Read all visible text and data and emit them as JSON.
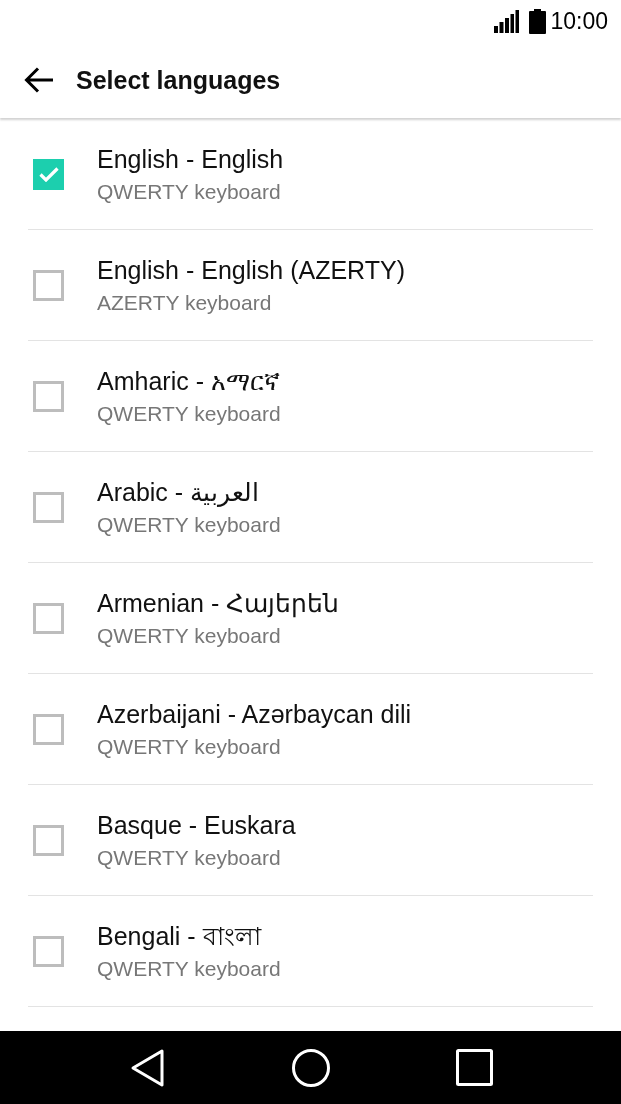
{
  "status_bar": {
    "time": "10:00"
  },
  "app_bar": {
    "title": "Select languages"
  },
  "languages": [
    {
      "name": "English - English",
      "layout": "QWERTY keyboard",
      "checked": true
    },
    {
      "name": "English - English (AZERTY)",
      "layout": "AZERTY keyboard",
      "checked": false
    },
    {
      "name": "Amharic - አማርኛ",
      "layout": "QWERTY keyboard",
      "checked": false
    },
    {
      "name": "Arabic - العربية",
      "layout": "QWERTY keyboard",
      "checked": false
    },
    {
      "name": "Armenian - Հայերեն",
      "layout": "QWERTY keyboard",
      "checked": false
    },
    {
      "name": "Azerbaijani - Azərbaycan dili",
      "layout": "QWERTY keyboard",
      "checked": false
    },
    {
      "name": "Basque - Euskara",
      "layout": "QWERTY keyboard",
      "checked": false
    },
    {
      "name": "Bengali - বাংলা",
      "layout": "QWERTY keyboard",
      "checked": false
    }
  ]
}
